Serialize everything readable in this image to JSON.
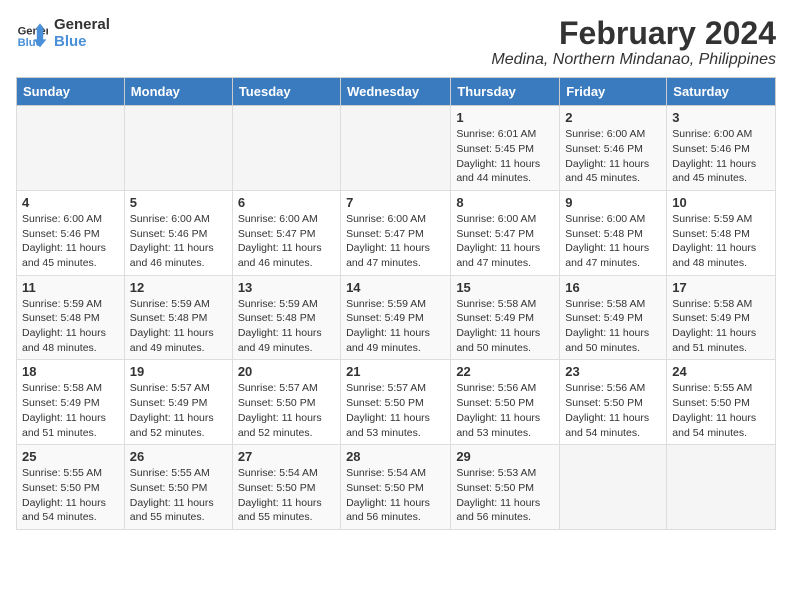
{
  "logo": {
    "line1": "General",
    "line2": "Blue"
  },
  "title": "February 2024",
  "subtitle": "Medina, Northern Mindanao, Philippines",
  "days_of_week": [
    "Sunday",
    "Monday",
    "Tuesday",
    "Wednesday",
    "Thursday",
    "Friday",
    "Saturday"
  ],
  "weeks": [
    [
      {
        "num": "",
        "info": ""
      },
      {
        "num": "",
        "info": ""
      },
      {
        "num": "",
        "info": ""
      },
      {
        "num": "",
        "info": ""
      },
      {
        "num": "1",
        "info": "Sunrise: 6:01 AM\nSunset: 5:45 PM\nDaylight: 11 hours and 44 minutes."
      },
      {
        "num": "2",
        "info": "Sunrise: 6:00 AM\nSunset: 5:46 PM\nDaylight: 11 hours and 45 minutes."
      },
      {
        "num": "3",
        "info": "Sunrise: 6:00 AM\nSunset: 5:46 PM\nDaylight: 11 hours and 45 minutes."
      }
    ],
    [
      {
        "num": "4",
        "info": "Sunrise: 6:00 AM\nSunset: 5:46 PM\nDaylight: 11 hours and 45 minutes."
      },
      {
        "num": "5",
        "info": "Sunrise: 6:00 AM\nSunset: 5:46 PM\nDaylight: 11 hours and 46 minutes."
      },
      {
        "num": "6",
        "info": "Sunrise: 6:00 AM\nSunset: 5:47 PM\nDaylight: 11 hours and 46 minutes."
      },
      {
        "num": "7",
        "info": "Sunrise: 6:00 AM\nSunset: 5:47 PM\nDaylight: 11 hours and 47 minutes."
      },
      {
        "num": "8",
        "info": "Sunrise: 6:00 AM\nSunset: 5:47 PM\nDaylight: 11 hours and 47 minutes."
      },
      {
        "num": "9",
        "info": "Sunrise: 6:00 AM\nSunset: 5:48 PM\nDaylight: 11 hours and 47 minutes."
      },
      {
        "num": "10",
        "info": "Sunrise: 5:59 AM\nSunset: 5:48 PM\nDaylight: 11 hours and 48 minutes."
      }
    ],
    [
      {
        "num": "11",
        "info": "Sunrise: 5:59 AM\nSunset: 5:48 PM\nDaylight: 11 hours and 48 minutes."
      },
      {
        "num": "12",
        "info": "Sunrise: 5:59 AM\nSunset: 5:48 PM\nDaylight: 11 hours and 49 minutes."
      },
      {
        "num": "13",
        "info": "Sunrise: 5:59 AM\nSunset: 5:48 PM\nDaylight: 11 hours and 49 minutes."
      },
      {
        "num": "14",
        "info": "Sunrise: 5:59 AM\nSunset: 5:49 PM\nDaylight: 11 hours and 49 minutes."
      },
      {
        "num": "15",
        "info": "Sunrise: 5:58 AM\nSunset: 5:49 PM\nDaylight: 11 hours and 50 minutes."
      },
      {
        "num": "16",
        "info": "Sunrise: 5:58 AM\nSunset: 5:49 PM\nDaylight: 11 hours and 50 minutes."
      },
      {
        "num": "17",
        "info": "Sunrise: 5:58 AM\nSunset: 5:49 PM\nDaylight: 11 hours and 51 minutes."
      }
    ],
    [
      {
        "num": "18",
        "info": "Sunrise: 5:58 AM\nSunset: 5:49 PM\nDaylight: 11 hours and 51 minutes."
      },
      {
        "num": "19",
        "info": "Sunrise: 5:57 AM\nSunset: 5:49 PM\nDaylight: 11 hours and 52 minutes."
      },
      {
        "num": "20",
        "info": "Sunrise: 5:57 AM\nSunset: 5:50 PM\nDaylight: 11 hours and 52 minutes."
      },
      {
        "num": "21",
        "info": "Sunrise: 5:57 AM\nSunset: 5:50 PM\nDaylight: 11 hours and 53 minutes."
      },
      {
        "num": "22",
        "info": "Sunrise: 5:56 AM\nSunset: 5:50 PM\nDaylight: 11 hours and 53 minutes."
      },
      {
        "num": "23",
        "info": "Sunrise: 5:56 AM\nSunset: 5:50 PM\nDaylight: 11 hours and 54 minutes."
      },
      {
        "num": "24",
        "info": "Sunrise: 5:55 AM\nSunset: 5:50 PM\nDaylight: 11 hours and 54 minutes."
      }
    ],
    [
      {
        "num": "25",
        "info": "Sunrise: 5:55 AM\nSunset: 5:50 PM\nDaylight: 11 hours and 54 minutes."
      },
      {
        "num": "26",
        "info": "Sunrise: 5:55 AM\nSunset: 5:50 PM\nDaylight: 11 hours and 55 minutes."
      },
      {
        "num": "27",
        "info": "Sunrise: 5:54 AM\nSunset: 5:50 PM\nDaylight: 11 hours and 55 minutes."
      },
      {
        "num": "28",
        "info": "Sunrise: 5:54 AM\nSunset: 5:50 PM\nDaylight: 11 hours and 56 minutes."
      },
      {
        "num": "29",
        "info": "Sunrise: 5:53 AM\nSunset: 5:50 PM\nDaylight: 11 hours and 56 minutes."
      },
      {
        "num": "",
        "info": ""
      },
      {
        "num": "",
        "info": ""
      }
    ]
  ]
}
